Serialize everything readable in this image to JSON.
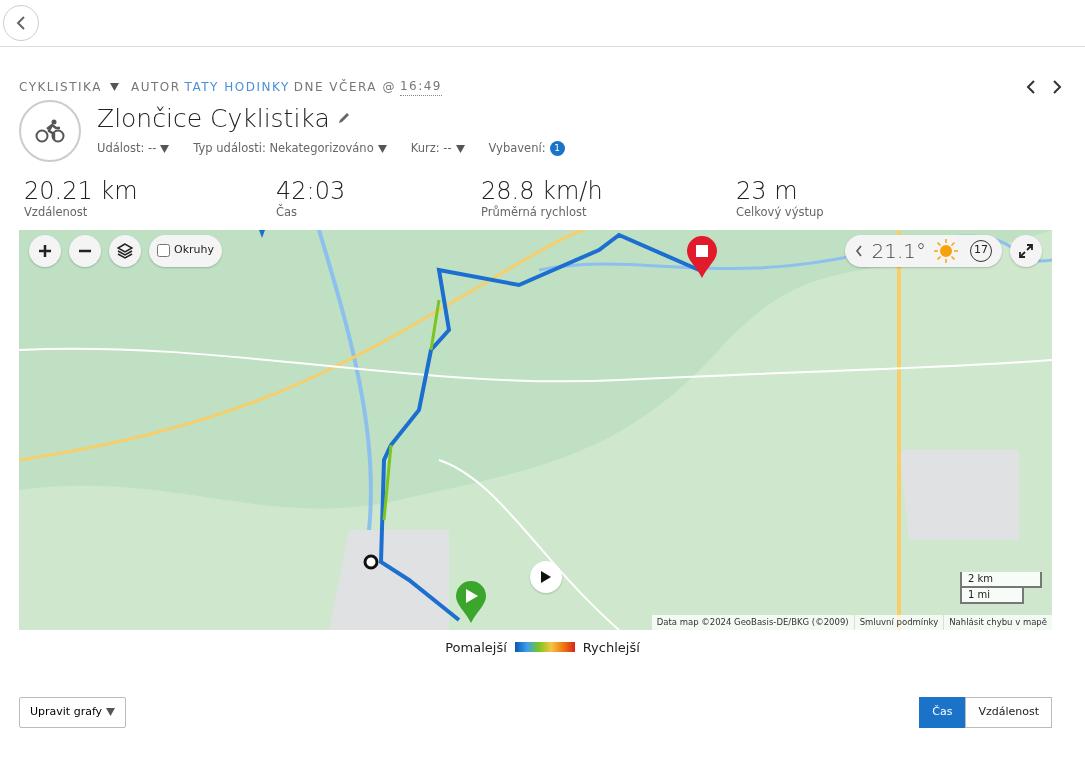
{
  "activity": {
    "type": "CYKLISTIKA",
    "author_prefix": "AUTOR",
    "author": "TATY HODINKY",
    "date_text": "DNE VČERA @",
    "time": "16:49",
    "title": "Zlončice Cyklistika"
  },
  "meta": [
    {
      "kind": "dropdown",
      "label": "Událost: --"
    },
    {
      "kind": "dropdown",
      "label": "Typ události: Nekategorizováno"
    },
    {
      "kind": "dropdown",
      "label": "Kurz: --"
    },
    {
      "kind": "count",
      "label": "Vybavení:",
      "count": "1"
    }
  ],
  "stats": [
    {
      "value": "20.21 km",
      "label": "Vzdálenost"
    },
    {
      "value": "42:03",
      "label": "Čas"
    },
    {
      "value": "28.8 km/h",
      "label": "Průměrná rychlost"
    },
    {
      "value": "23 m",
      "label": "Celkový výstup"
    }
  ],
  "map": {
    "laps": {
      "label": "Okruhy",
      "checked": false
    },
    "weather": {
      "temperature": "21.1°",
      "wind": "17"
    },
    "scale": [
      "2 km",
      "1 mi"
    ],
    "attribution": [
      "Data map ©2024 GeoBasis-DE/BKG (©2009)",
      "Smluvní podmínky",
      "Nahlásit chybu v mapě"
    ]
  },
  "legend": {
    "slower": "Pomalejší",
    "faster": "Rychlejší"
  },
  "chart_button": "Upravit grafy",
  "axis_toggle": [
    {
      "label": "Čas",
      "selected": true
    },
    {
      "label": "Vzdálenost",
      "selected": false
    }
  ]
}
